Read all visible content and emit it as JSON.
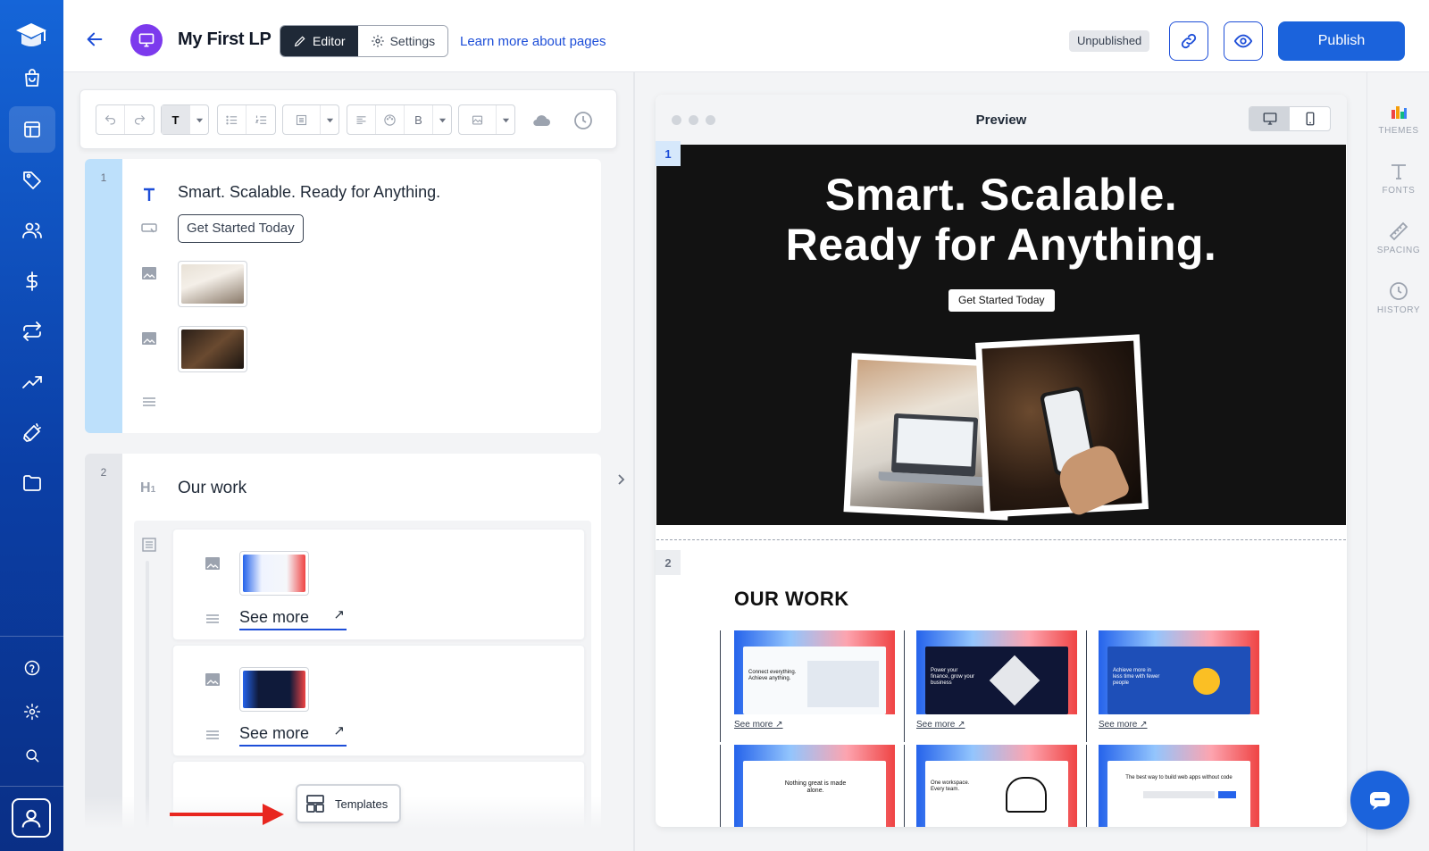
{
  "sidebar": {
    "logo_icon": "graduation-cap-icon",
    "items": [
      {
        "icon": "shopping-bag-icon"
      },
      {
        "icon": "layout-icon",
        "active": true
      },
      {
        "icon": "tag-icon"
      },
      {
        "icon": "users-icon"
      },
      {
        "icon": "dollar-icon"
      },
      {
        "icon": "repeat-icon"
      },
      {
        "icon": "trending-up-icon"
      },
      {
        "icon": "megaphone-icon"
      },
      {
        "icon": "folder-icon"
      }
    ],
    "bottom_items": [
      {
        "icon": "help-circle-icon"
      },
      {
        "icon": "gear-icon"
      },
      {
        "icon": "search-icon"
      }
    ],
    "account_icon": "user-icon"
  },
  "header": {
    "title": "My First LP",
    "editor_label": "Editor",
    "settings_label": "Settings",
    "learn_more": "Learn more about pages",
    "status": "Unpublished",
    "publish_label": "Publish",
    "accent": "#1b63dc"
  },
  "editor": {
    "block1": {
      "number": "1",
      "heading_text": "Smart. Scalable. Ready for Anything.",
      "button_text": "Get Started Today"
    },
    "block2": {
      "number": "2",
      "heading_text": "Our work",
      "cards": [
        {
          "link": "See more"
        },
        {
          "link": "See more"
        }
      ]
    },
    "templates_label": "Templates"
  },
  "preview": {
    "title": "Preview",
    "hero_line1": "Smart. Scalable.",
    "hero_line2": "Ready for Anything.",
    "hero_button": "Get Started Today",
    "section1": "1",
    "section2": "2",
    "our_work_title": "OUR WORK",
    "work_items": [
      {
        "link": "See more ↗",
        "caption": "Connect everything. Achieve anything."
      },
      {
        "link": "See more ↗",
        "caption": "Power your finance, grow your business"
      },
      {
        "link": "See more ↗",
        "caption": "Achieve more in less time with fewer people"
      },
      {
        "caption": "Nothing great is made alone."
      },
      {
        "caption": "One workspace. Every team."
      },
      {
        "caption": "The best way to build web apps without code"
      }
    ]
  },
  "rightbar": {
    "items": [
      {
        "label": "THEMES",
        "icon": "palette-icon"
      },
      {
        "label": "FONTS",
        "icon": "type-icon"
      },
      {
        "label": "SPACING",
        "icon": "ruler-icon"
      },
      {
        "label": "HISTORY",
        "icon": "clock-icon"
      }
    ]
  }
}
